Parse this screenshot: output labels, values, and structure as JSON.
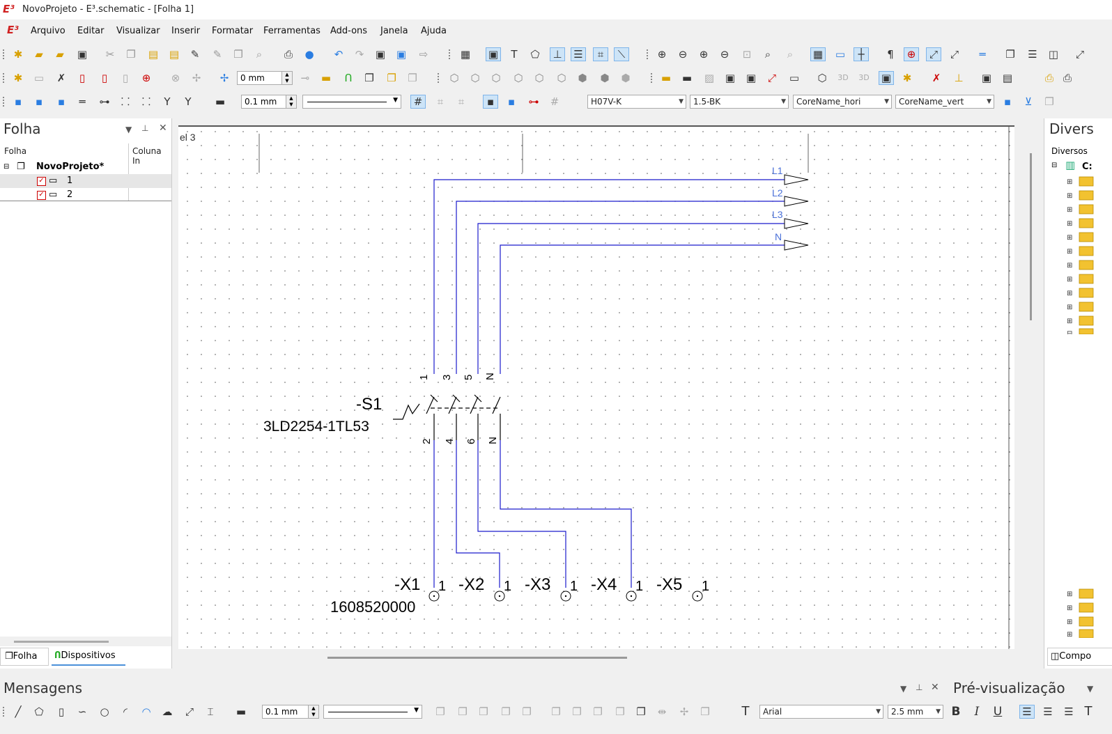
{
  "titlebar": {
    "logo": "E³",
    "title": "NovoProjeto - E³.schematic - [Folha 1]"
  },
  "menubar": {
    "logo": "E³",
    "items": [
      "Arquivo",
      "Editar",
      "Visualizar",
      "Inserir",
      "Formatar",
      "Ferramentas",
      "Add-ons",
      "Janela",
      "Ajuda"
    ]
  },
  "toolbar1": {
    "icons": [
      "new-icon",
      "open-icon",
      "open-project-icon",
      "save-icon",
      "cut-icon",
      "copy-icon",
      "paste-icon",
      "paste-special-icon",
      "format-painter-icon",
      "brush-icon",
      "copy-format-icon",
      "find-icon",
      "print-icon",
      "help-icon",
      "undo-icon",
      "redo-icon",
      "save-all-icon",
      "export-icon",
      "arrow-right-icon",
      "table-icon",
      "component-icon",
      "text-icon",
      "polygon-icon",
      "symbol-icon",
      "align-icon",
      "text-symbol-icon",
      "wire-icon",
      "zoom-in-icon",
      "zoom-out-icon",
      "zoom-plus-icon",
      "zoom-minus-icon",
      "zoom-fit-icon",
      "zoom-area-icon",
      "zoom-select-icon",
      "grid-icon",
      "layer-icon",
      "snap-icon",
      "paragraph-icon",
      "connect-icon",
      "link-icon",
      "route-icon",
      "line-icon",
      "windows-icon",
      "horizontal-split-icon",
      "vertical-split-icon",
      "extra-icon"
    ]
  },
  "toolbar2": {
    "offset_value": "0 mm"
  },
  "toolbar3": {
    "line_width": "0.1 mm",
    "wire_type": "H07V-K",
    "wire_color": "1.5-BK",
    "core_name_hori": "CoreName_hori",
    "core_name_vert": "CoreName_vert"
  },
  "left_panel": {
    "title": "Folha",
    "columns": [
      "Folha",
      "Coluna In"
    ],
    "tree": {
      "project": "NovoProjeto*",
      "sheets": [
        "1",
        "2"
      ]
    },
    "tabs": [
      "Folha",
      "Dispositivos"
    ]
  },
  "right_panel": {
    "title": "Divers",
    "column": "Diversos",
    "root": "C:",
    "tab": "Compo"
  },
  "schematic": {
    "corner_label": "el 3",
    "signals": [
      "L1",
      "L2",
      "L3",
      "N"
    ],
    "switch_name": "-S1",
    "switch_part": "3LD2254-1TL53",
    "top_pins": [
      "1",
      "3",
      "5",
      "N"
    ],
    "bottom_pins": [
      "2",
      "4",
      "6",
      "N"
    ],
    "terminals": [
      {
        "name": "-X1",
        "pin": "1"
      },
      {
        "name": "-X2",
        "pin": "1"
      },
      {
        "name": "-X3",
        "pin": "1"
      },
      {
        "name": "-X4",
        "pin": "1"
      },
      {
        "name": "-X5",
        "pin": "1"
      }
    ],
    "terminal_part": "1608520000",
    "wire_color": "#1a1acc"
  },
  "bottom": {
    "messages_title": "Mensagens",
    "preview_title": "Pré-visualização",
    "line_width": "0.1 mm",
    "font": "Arial",
    "font_size": "2.5 mm",
    "bold": "B",
    "italic": "I",
    "underline": "U"
  }
}
